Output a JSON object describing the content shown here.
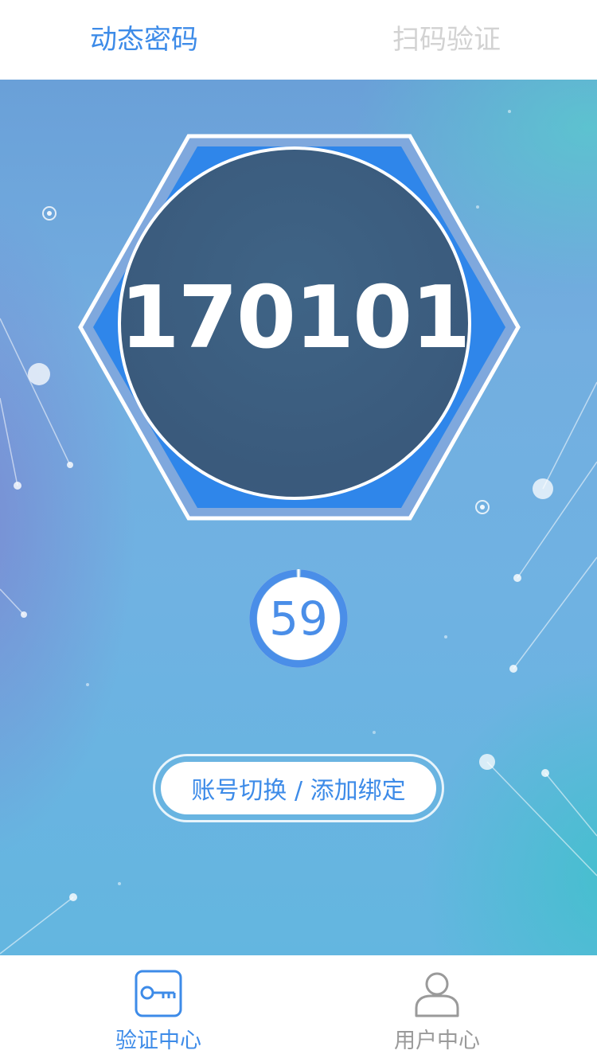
{
  "header": {
    "tabs": [
      {
        "label": "动态密码",
        "active": true
      },
      {
        "label": "扫码验证",
        "active": false
      }
    ]
  },
  "main": {
    "code": "170101",
    "countdown": "59",
    "switch_button_label": "账号切换 / 添加绑定"
  },
  "bottom_nav": {
    "items": [
      {
        "label": "验证中心",
        "icon": "key-icon",
        "active": true
      },
      {
        "label": "用户中心",
        "icon": "user-icon",
        "active": false
      }
    ]
  },
  "colors": {
    "accent": "#3d8be8",
    "inactive_tab": "#d2d2d2",
    "inactive_nav": "#9a9a9a",
    "code_circle": "#3d5b80",
    "hex_fill": "#2f86ea"
  }
}
